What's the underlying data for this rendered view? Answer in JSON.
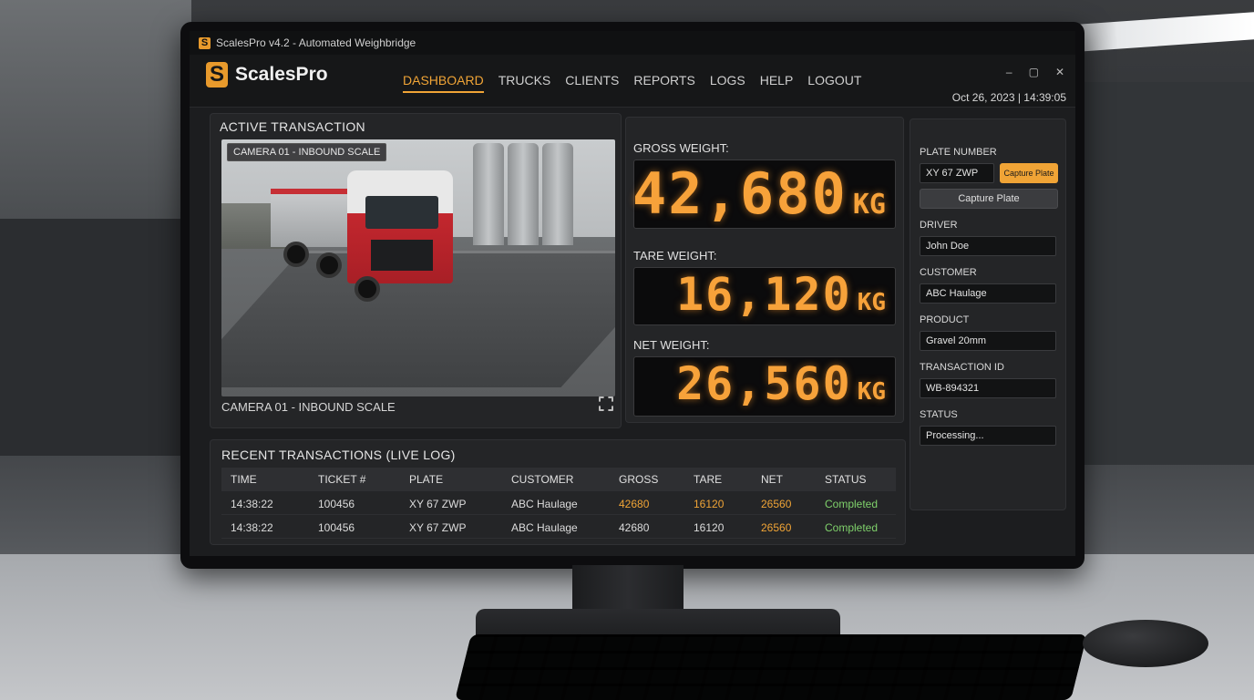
{
  "window": {
    "title": "ScalesPro v4.2 - Automated Weighbridge"
  },
  "app": {
    "name": "ScalesPro",
    "logo_letter": "S"
  },
  "nav": {
    "items": [
      {
        "label": "DASHBOARD"
      },
      {
        "label": "TRUCKS"
      },
      {
        "label": "CLIENTS"
      },
      {
        "label": "REPORTS"
      },
      {
        "label": "LOGS"
      },
      {
        "label": "HELP"
      },
      {
        "label": "LOGOUT"
      }
    ]
  },
  "window_controls": {
    "minimize": "–",
    "maximize": "▢",
    "close": "✕"
  },
  "datetime": "Oct 26, 2023 | 14:39:05",
  "active_transaction": {
    "title": "ACTIVE TRANSACTION",
    "camera_badge": "CAMERA 01 - INBOUND SCALE",
    "camera_caption": "CAMERA 01 - INBOUND SCALE"
  },
  "weights": {
    "gross": {
      "label": "GROSS WEIGHT:",
      "value": "42,680",
      "unit": "KG"
    },
    "tare": {
      "label": "TARE WEIGHT:",
      "value": "16,120",
      "unit": "KG"
    },
    "net": {
      "label": "NET WEIGHT:",
      "value": "26,560",
      "unit": "KG"
    }
  },
  "form": {
    "plate_label": "PLATE NUMBER",
    "plate_value": "XY 67 ZWP",
    "capture_small": "Capture Plate",
    "capture_button": "Capture Plate",
    "driver_label": "DRIVER",
    "driver_value": "John Doe",
    "customer_label": "CUSTOMER",
    "customer_value": "ABC Haulage",
    "product_label": "PRODUCT",
    "product_value": "Gravel 20mm",
    "transaction_label": "TRANSACTION ID",
    "transaction_value": "WB-894321",
    "status_label": "STATUS",
    "status_value": "Processing..."
  },
  "recent": {
    "title": "RECENT TRANSACTIONS (LIVE LOG)",
    "columns": [
      "TIME",
      "TICKET #",
      "PLATE",
      "CUSTOMER",
      "GROSS",
      "TARE",
      "NET",
      "STATUS"
    ],
    "rows": [
      {
        "time": "14:38:22",
        "ticket": "100456",
        "plate": "XY 67 ZWP",
        "customer": "ABC Haulage",
        "gross": "42680",
        "tare": "16120",
        "net": "26560",
        "status": "Completed"
      },
      {
        "time": "14:38:22",
        "ticket": "100456",
        "plate": "XY 67 ZWP",
        "customer": "ABC Haulage",
        "gross": "42680",
        "tare": "16120",
        "net": "26560",
        "status": "Completed"
      }
    ]
  },
  "colors": {
    "accent": "#f0a436",
    "status_ok": "#7fd16b",
    "lcd": "#f7a23a"
  },
  "icons": {
    "expand": "expand-icon"
  }
}
